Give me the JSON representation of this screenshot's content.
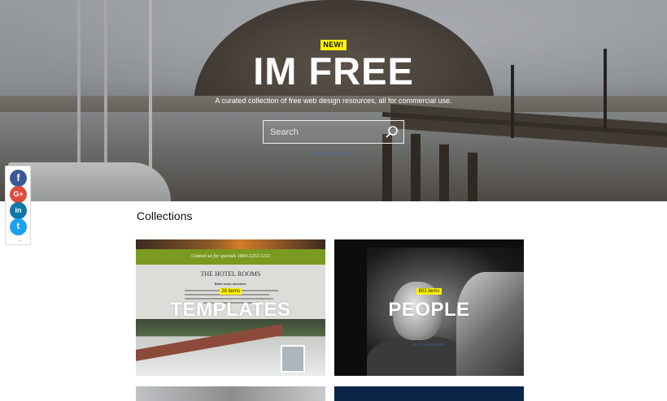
{
  "hero": {
    "badge": "NEW!",
    "title": "IM FREE",
    "tagline": "A curated collection of free web design resources, all for commercial use.",
    "search_placeholder": "Search",
    "photo_credit": "pic by Bhavesh Kumar..."
  },
  "share": {
    "facebook_label": "f",
    "google_plus_label": "G+",
    "linkedin_label": "in",
    "twitter_label": "t",
    "collapse_label": "←"
  },
  "collections": {
    "title": "Collections",
    "cards": [
      {
        "label": "TEMPLATES",
        "count": "26 items",
        "thumbnail": {
          "banner": "Contact us for specials 1800-1232-1232",
          "heading": "THE HOTEL ROOMS",
          "subheading": "Each room includes:"
        }
      },
      {
        "label": "PEOPLE",
        "count": "803 items",
        "credit": "pic by Gracawallet"
      }
    ]
  },
  "colors": {
    "badge_yellow": "#fff200",
    "facebook": "#3b5998",
    "google_plus": "#dd4b39",
    "linkedin": "#0e76a8",
    "twitter": "#1da1f2"
  }
}
